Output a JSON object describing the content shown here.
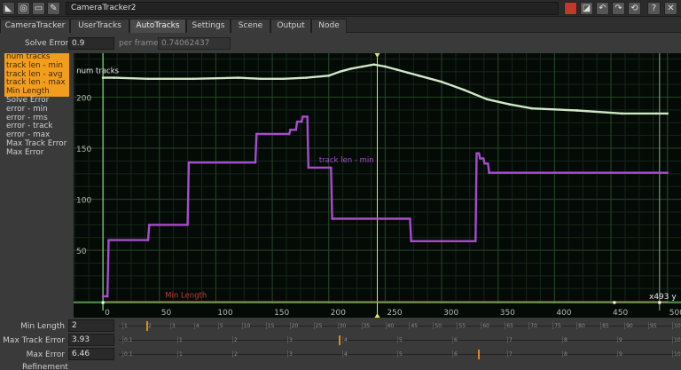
{
  "window": {
    "title": "CameraTracker2"
  },
  "tabs": [
    "CameraTracker",
    "UserTracks",
    "AutoTracks",
    "Settings",
    "Scene",
    "Output",
    "Node"
  ],
  "active_tab": "AutoTracks",
  "solve_error": {
    "label": "Solve Error",
    "value": "0.9",
    "per_frame_label": "per frame",
    "per_frame_value": "0.74062437"
  },
  "curve_list": [
    {
      "label": "num tracks",
      "selected": true
    },
    {
      "label": "track len - min",
      "selected": true
    },
    {
      "label": "track len - avg",
      "selected": true
    },
    {
      "label": "track len - max",
      "selected": true
    },
    {
      "label": "Min Length",
      "selected": true
    },
    {
      "label": "Solve Error",
      "selected": false
    },
    {
      "label": "error - min",
      "selected": false
    },
    {
      "label": "error - rms",
      "selected": false
    },
    {
      "label": "error - track",
      "selected": false
    },
    {
      "label": "error - max",
      "selected": false
    },
    {
      "label": "Max Track Error",
      "selected": false
    },
    {
      "label": "Max Error",
      "selected": false
    }
  ],
  "chart_data": {
    "type": "line",
    "x_ticks": [
      0,
      50,
      100,
      150,
      200,
      250,
      300,
      350,
      400,
      450,
      500
    ],
    "y_ticks": [
      50,
      100,
      150,
      200
    ],
    "current_frame": 243,
    "readout": "x493 y",
    "series": [
      {
        "name": "num tracks",
        "color": "#cfe8c8",
        "points": [
          [
            0,
            219
          ],
          [
            10,
            219
          ],
          [
            40,
            218
          ],
          [
            80,
            218
          ],
          [
            120,
            219
          ],
          [
            140,
            218
          ],
          [
            160,
            218
          ],
          [
            180,
            219
          ],
          [
            200,
            221
          ],
          [
            210,
            225
          ],
          [
            220,
            228
          ],
          [
            230,
            230
          ],
          [
            240,
            232
          ],
          [
            250,
            230
          ],
          [
            260,
            227
          ],
          [
            270,
            224
          ],
          [
            280,
            221
          ],
          [
            300,
            215
          ],
          [
            320,
            207
          ],
          [
            340,
            198
          ],
          [
            360,
            193
          ],
          [
            380,
            189
          ],
          [
            420,
            187
          ],
          [
            460,
            184
          ],
          [
            490,
            184
          ],
          [
            500,
            184
          ]
        ]
      },
      {
        "name": "track len - min",
        "color": "#a64dcf",
        "points": [
          [
            0,
            5
          ],
          [
            4,
            5
          ],
          [
            5,
            60
          ],
          [
            40,
            60
          ],
          [
            41,
            75
          ],
          [
            75,
            75
          ],
          [
            76,
            136
          ],
          [
            135,
            136
          ],
          [
            136,
            164
          ],
          [
            165,
            164
          ],
          [
            166,
            168
          ],
          [
            171,
            168
          ],
          [
            172,
            176
          ],
          [
            176,
            176
          ],
          [
            177,
            181
          ],
          [
            181,
            181
          ],
          [
            182,
            131
          ],
          [
            202,
            131
          ],
          [
            203,
            81
          ],
          [
            272,
            81
          ],
          [
            273,
            59
          ],
          [
            330,
            59
          ],
          [
            331,
            145
          ],
          [
            333,
            145
          ],
          [
            334,
            140
          ],
          [
            337,
            140
          ],
          [
            338,
            135
          ],
          [
            341,
            135
          ],
          [
            342,
            126
          ],
          [
            500,
            126
          ]
        ]
      },
      {
        "name": "Min Length",
        "color": "#c03a3a",
        "points": [
          [
            0,
            0
          ],
          [
            500,
            0
          ]
        ]
      }
    ],
    "annotations": [
      "num tracks",
      "track len - min",
      "Min Length"
    ],
    "xlim": [
      -26,
      512
    ],
    "ylim": [
      -2,
      243
    ]
  },
  "params": [
    {
      "label": "Min Length",
      "value": "2",
      "min": 1,
      "max": 100,
      "handle": 2
    },
    {
      "label": "Max Track Error",
      "value": "3.93",
      "min": 0,
      "max": 10,
      "handle": 3.93
    },
    {
      "label": "Max Error",
      "value": "6.46",
      "min": 0,
      "max": 10,
      "handle": 6.46
    }
  ],
  "param_tick_labels": [
    [
      "1",
      "2",
      "3",
      "4",
      "5",
      "10",
      "15",
      "20",
      "25",
      "30",
      "35",
      "40",
      "45",
      "50",
      "55",
      "60",
      "65",
      "70",
      "75",
      "80",
      "85",
      "90",
      "95",
      "100"
    ],
    [
      "0.1",
      "1",
      "2",
      "3",
      "4",
      "5",
      "6",
      "7",
      "8",
      "9",
      "10"
    ],
    [
      "0.1",
      "1",
      "2",
      "3",
      "4",
      "5",
      "6",
      "7",
      "8",
      "9",
      "10"
    ]
  ],
  "refinement_label": "Refinement",
  "colors": {
    "selection": "#f29d1c",
    "current_frame": "#e4e35a",
    "range_line": "#8be07a",
    "grid": "#26462a"
  }
}
